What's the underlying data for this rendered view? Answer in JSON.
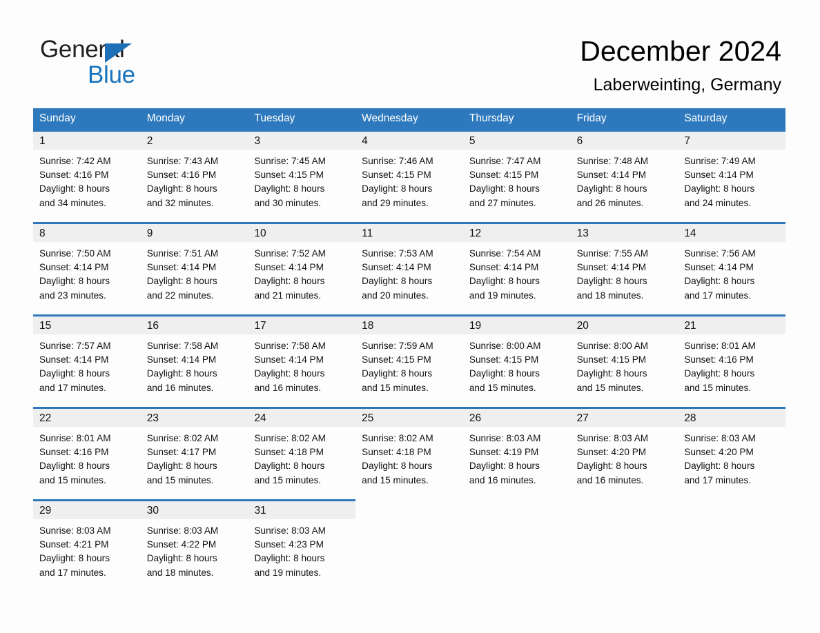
{
  "brand": {
    "name_part1": "General",
    "name_part2": "Blue",
    "accent_color": "#1874bd",
    "triangle_icon": "triangle-icon"
  },
  "header": {
    "title": "December 2024",
    "location": "Laberweinting, Germany"
  },
  "calendar": {
    "header_bg": "#2e79bd",
    "day_band_bg": "#efefef",
    "weekday_headers": [
      "Sunday",
      "Monday",
      "Tuesday",
      "Wednesday",
      "Thursday",
      "Friday",
      "Saturday"
    ],
    "weeks": [
      [
        {
          "day": "1",
          "sunrise": "Sunrise: 7:42 AM",
          "sunset": "Sunset: 4:16 PM",
          "daylight_line1": "Daylight: 8 hours",
          "daylight_line2": "and 34 minutes."
        },
        {
          "day": "2",
          "sunrise": "Sunrise: 7:43 AM",
          "sunset": "Sunset: 4:16 PM",
          "daylight_line1": "Daylight: 8 hours",
          "daylight_line2": "and 32 minutes."
        },
        {
          "day": "3",
          "sunrise": "Sunrise: 7:45 AM",
          "sunset": "Sunset: 4:15 PM",
          "daylight_line1": "Daylight: 8 hours",
          "daylight_line2": "and 30 minutes."
        },
        {
          "day": "4",
          "sunrise": "Sunrise: 7:46 AM",
          "sunset": "Sunset: 4:15 PM",
          "daylight_line1": "Daylight: 8 hours",
          "daylight_line2": "and 29 minutes."
        },
        {
          "day": "5",
          "sunrise": "Sunrise: 7:47 AM",
          "sunset": "Sunset: 4:15 PM",
          "daylight_line1": "Daylight: 8 hours",
          "daylight_line2": "and 27 minutes."
        },
        {
          "day": "6",
          "sunrise": "Sunrise: 7:48 AM",
          "sunset": "Sunset: 4:14 PM",
          "daylight_line1": "Daylight: 8 hours",
          "daylight_line2": "and 26 minutes."
        },
        {
          "day": "7",
          "sunrise": "Sunrise: 7:49 AM",
          "sunset": "Sunset: 4:14 PM",
          "daylight_line1": "Daylight: 8 hours",
          "daylight_line2": "and 24 minutes."
        }
      ],
      [
        {
          "day": "8",
          "sunrise": "Sunrise: 7:50 AM",
          "sunset": "Sunset: 4:14 PM",
          "daylight_line1": "Daylight: 8 hours",
          "daylight_line2": "and 23 minutes."
        },
        {
          "day": "9",
          "sunrise": "Sunrise: 7:51 AM",
          "sunset": "Sunset: 4:14 PM",
          "daylight_line1": "Daylight: 8 hours",
          "daylight_line2": "and 22 minutes."
        },
        {
          "day": "10",
          "sunrise": "Sunrise: 7:52 AM",
          "sunset": "Sunset: 4:14 PM",
          "daylight_line1": "Daylight: 8 hours",
          "daylight_line2": "and 21 minutes."
        },
        {
          "day": "11",
          "sunrise": "Sunrise: 7:53 AM",
          "sunset": "Sunset: 4:14 PM",
          "daylight_line1": "Daylight: 8 hours",
          "daylight_line2": "and 20 minutes."
        },
        {
          "day": "12",
          "sunrise": "Sunrise: 7:54 AM",
          "sunset": "Sunset: 4:14 PM",
          "daylight_line1": "Daylight: 8 hours",
          "daylight_line2": "and 19 minutes."
        },
        {
          "day": "13",
          "sunrise": "Sunrise: 7:55 AM",
          "sunset": "Sunset: 4:14 PM",
          "daylight_line1": "Daylight: 8 hours",
          "daylight_line2": "and 18 minutes."
        },
        {
          "day": "14",
          "sunrise": "Sunrise: 7:56 AM",
          "sunset": "Sunset: 4:14 PM",
          "daylight_line1": "Daylight: 8 hours",
          "daylight_line2": "and 17 minutes."
        }
      ],
      [
        {
          "day": "15",
          "sunrise": "Sunrise: 7:57 AM",
          "sunset": "Sunset: 4:14 PM",
          "daylight_line1": "Daylight: 8 hours",
          "daylight_line2": "and 17 minutes."
        },
        {
          "day": "16",
          "sunrise": "Sunrise: 7:58 AM",
          "sunset": "Sunset: 4:14 PM",
          "daylight_line1": "Daylight: 8 hours",
          "daylight_line2": "and 16 minutes."
        },
        {
          "day": "17",
          "sunrise": "Sunrise: 7:58 AM",
          "sunset": "Sunset: 4:14 PM",
          "daylight_line1": "Daylight: 8 hours",
          "daylight_line2": "and 16 minutes."
        },
        {
          "day": "18",
          "sunrise": "Sunrise: 7:59 AM",
          "sunset": "Sunset: 4:15 PM",
          "daylight_line1": "Daylight: 8 hours",
          "daylight_line2": "and 15 minutes."
        },
        {
          "day": "19",
          "sunrise": "Sunrise: 8:00 AM",
          "sunset": "Sunset: 4:15 PM",
          "daylight_line1": "Daylight: 8 hours",
          "daylight_line2": "and 15 minutes."
        },
        {
          "day": "20",
          "sunrise": "Sunrise: 8:00 AM",
          "sunset": "Sunset: 4:15 PM",
          "daylight_line1": "Daylight: 8 hours",
          "daylight_line2": "and 15 minutes."
        },
        {
          "day": "21",
          "sunrise": "Sunrise: 8:01 AM",
          "sunset": "Sunset: 4:16 PM",
          "daylight_line1": "Daylight: 8 hours",
          "daylight_line2": "and 15 minutes."
        }
      ],
      [
        {
          "day": "22",
          "sunrise": "Sunrise: 8:01 AM",
          "sunset": "Sunset: 4:16 PM",
          "daylight_line1": "Daylight: 8 hours",
          "daylight_line2": "and 15 minutes."
        },
        {
          "day": "23",
          "sunrise": "Sunrise: 8:02 AM",
          "sunset": "Sunset: 4:17 PM",
          "daylight_line1": "Daylight: 8 hours",
          "daylight_line2": "and 15 minutes."
        },
        {
          "day": "24",
          "sunrise": "Sunrise: 8:02 AM",
          "sunset": "Sunset: 4:18 PM",
          "daylight_line1": "Daylight: 8 hours",
          "daylight_line2": "and 15 minutes."
        },
        {
          "day": "25",
          "sunrise": "Sunrise: 8:02 AM",
          "sunset": "Sunset: 4:18 PM",
          "daylight_line1": "Daylight: 8 hours",
          "daylight_line2": "and 15 minutes."
        },
        {
          "day": "26",
          "sunrise": "Sunrise: 8:03 AM",
          "sunset": "Sunset: 4:19 PM",
          "daylight_line1": "Daylight: 8 hours",
          "daylight_line2": "and 16 minutes."
        },
        {
          "day": "27",
          "sunrise": "Sunrise: 8:03 AM",
          "sunset": "Sunset: 4:20 PM",
          "daylight_line1": "Daylight: 8 hours",
          "daylight_line2": "and 16 minutes."
        },
        {
          "day": "28",
          "sunrise": "Sunrise: 8:03 AM",
          "sunset": "Sunset: 4:20 PM",
          "daylight_line1": "Daylight: 8 hours",
          "daylight_line2": "and 17 minutes."
        }
      ],
      [
        {
          "day": "29",
          "sunrise": "Sunrise: 8:03 AM",
          "sunset": "Sunset: 4:21 PM",
          "daylight_line1": "Daylight: 8 hours",
          "daylight_line2": "and 17 minutes."
        },
        {
          "day": "30",
          "sunrise": "Sunrise: 8:03 AM",
          "sunset": "Sunset: 4:22 PM",
          "daylight_line1": "Daylight: 8 hours",
          "daylight_line2": "and 18 minutes."
        },
        {
          "day": "31",
          "sunrise": "Sunrise: 8:03 AM",
          "sunset": "Sunset: 4:23 PM",
          "daylight_line1": "Daylight: 8 hours",
          "daylight_line2": "and 19 minutes."
        },
        {
          "day": "",
          "sunrise": "",
          "sunset": "",
          "daylight_line1": "",
          "daylight_line2": ""
        },
        {
          "day": "",
          "sunrise": "",
          "sunset": "",
          "daylight_line1": "",
          "daylight_line2": ""
        },
        {
          "day": "",
          "sunrise": "",
          "sunset": "",
          "daylight_line1": "",
          "daylight_line2": ""
        },
        {
          "day": "",
          "sunrise": "",
          "sunset": "",
          "daylight_line1": "",
          "daylight_line2": ""
        }
      ]
    ]
  }
}
